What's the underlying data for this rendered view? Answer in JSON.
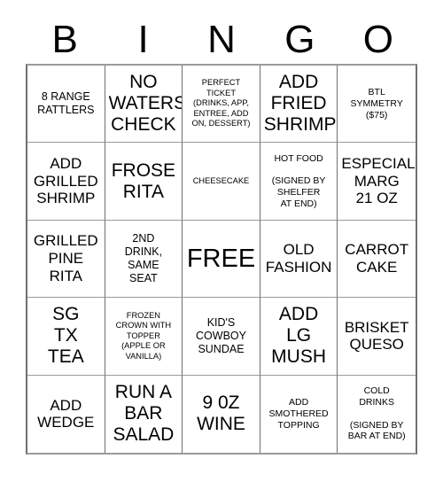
{
  "header": {
    "letters": [
      "B",
      "I",
      "N",
      "G",
      "O"
    ]
  },
  "grid": {
    "rows": 5,
    "columns": 5,
    "cells": [
      {
        "text": "8 RANGE\nRATTLERS",
        "size": "sz-sm",
        "free": false
      },
      {
        "text": "NO\nWATERS\nCHECK",
        "size": "sz-lg",
        "free": false
      },
      {
        "text": "PERFECT\nTICKET\n(DRINKS, APP,\nENTREE, ADD\nON, DESSERT)",
        "size": "sz-xxs",
        "free": false
      },
      {
        "text": "ADD\nFRIED\nSHRIMP",
        "size": "sz-lg",
        "free": false
      },
      {
        "text": "BTL\nSYMMETRY\n($75)",
        "size": "sz-xs",
        "free": false
      },
      {
        "text": "ADD\nGRILLED\nSHRIMP",
        "size": "sz-md",
        "free": false
      },
      {
        "text": "FROSE\nRITA",
        "size": "sz-lg",
        "free": false
      },
      {
        "text": "CHEESECAKE",
        "size": "sz-xxs",
        "free": false
      },
      {
        "text": "HOT FOOD\n\n(SIGNED BY\nSHELFER\nAT END)",
        "size": "sz-xs",
        "free": false
      },
      {
        "text": "ESPECIAL\nMARG\n21 OZ",
        "size": "sz-md",
        "free": false
      },
      {
        "text": "GRILLED\nPINE\nRITA",
        "size": "sz-md",
        "free": false
      },
      {
        "text": "2ND\nDRINK,\nSAME\nSEAT",
        "size": "sz-sm",
        "free": false
      },
      {
        "text": "FREE",
        "size": "sz-xl",
        "free": true
      },
      {
        "text": "OLD\nFASHION",
        "size": "sz-md",
        "free": false
      },
      {
        "text": "CARROT\nCAKE",
        "size": "sz-md",
        "free": false
      },
      {
        "text": "SG\nTX\nTEA",
        "size": "sz-lg",
        "free": false
      },
      {
        "text": "FROZEN\nCROWN WITH\nTOPPER\n(APPLE OR\nVANILLA)",
        "size": "sz-xxs",
        "free": false
      },
      {
        "text": "KID'S\nCOWBOY\nSUNDAE",
        "size": "sz-sm",
        "free": false
      },
      {
        "text": "ADD\nLG\nMUSH",
        "size": "sz-lg",
        "free": false
      },
      {
        "text": "BRISKET\nQUESO",
        "size": "sz-md",
        "free": false
      },
      {
        "text": "ADD\nWEDGE",
        "size": "sz-md",
        "free": false
      },
      {
        "text": "RUN A\nBAR\nSALAD",
        "size": "sz-lg",
        "free": false
      },
      {
        "text": "9 0Z\nWINE",
        "size": "sz-lg",
        "free": false
      },
      {
        "text": "ADD\nSMOTHERED\nTOPPING",
        "size": "sz-xs",
        "free": false
      },
      {
        "text": "COLD\nDRINKS\n\n(SIGNED BY\nBAR AT END)",
        "size": "sz-xs",
        "free": false
      }
    ]
  },
  "colors": {
    "background": "#ffffff",
    "text": "#000000",
    "grid_line": "#6f6f6f"
  }
}
